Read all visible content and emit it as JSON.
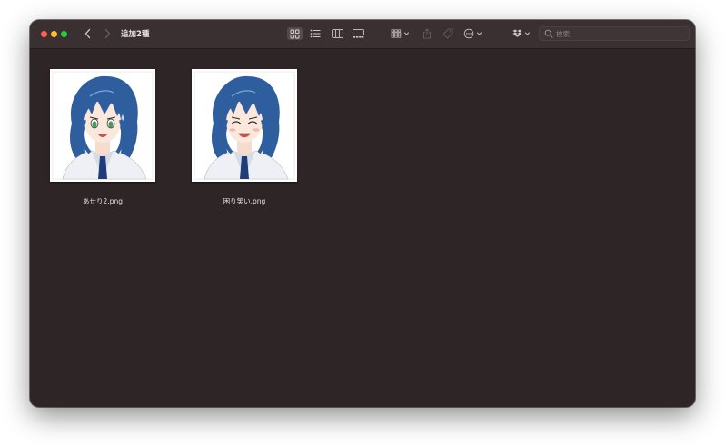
{
  "window": {
    "title": "追加2種"
  },
  "toolbar": {
    "view_buttons": [
      "icon-view-icon",
      "list-view-icon",
      "column-view-icon",
      "gallery-view-icon"
    ],
    "selected_view": "icon",
    "search": {
      "placeholder": "検索",
      "value": ""
    }
  },
  "files": [
    {
      "name": "あせり2.png",
      "expression": "worried"
    },
    {
      "name": "困り笑い.png",
      "expression": "troubled-smile"
    }
  ],
  "colors": {
    "window_bg": "#2e2526",
    "toolbar_bg": "#3a3032",
    "text": "#e8e2e3",
    "close": "#ff5f57",
    "minimize": "#febc2e",
    "maximize": "#28c840",
    "hair": "#2f5e9e"
  }
}
